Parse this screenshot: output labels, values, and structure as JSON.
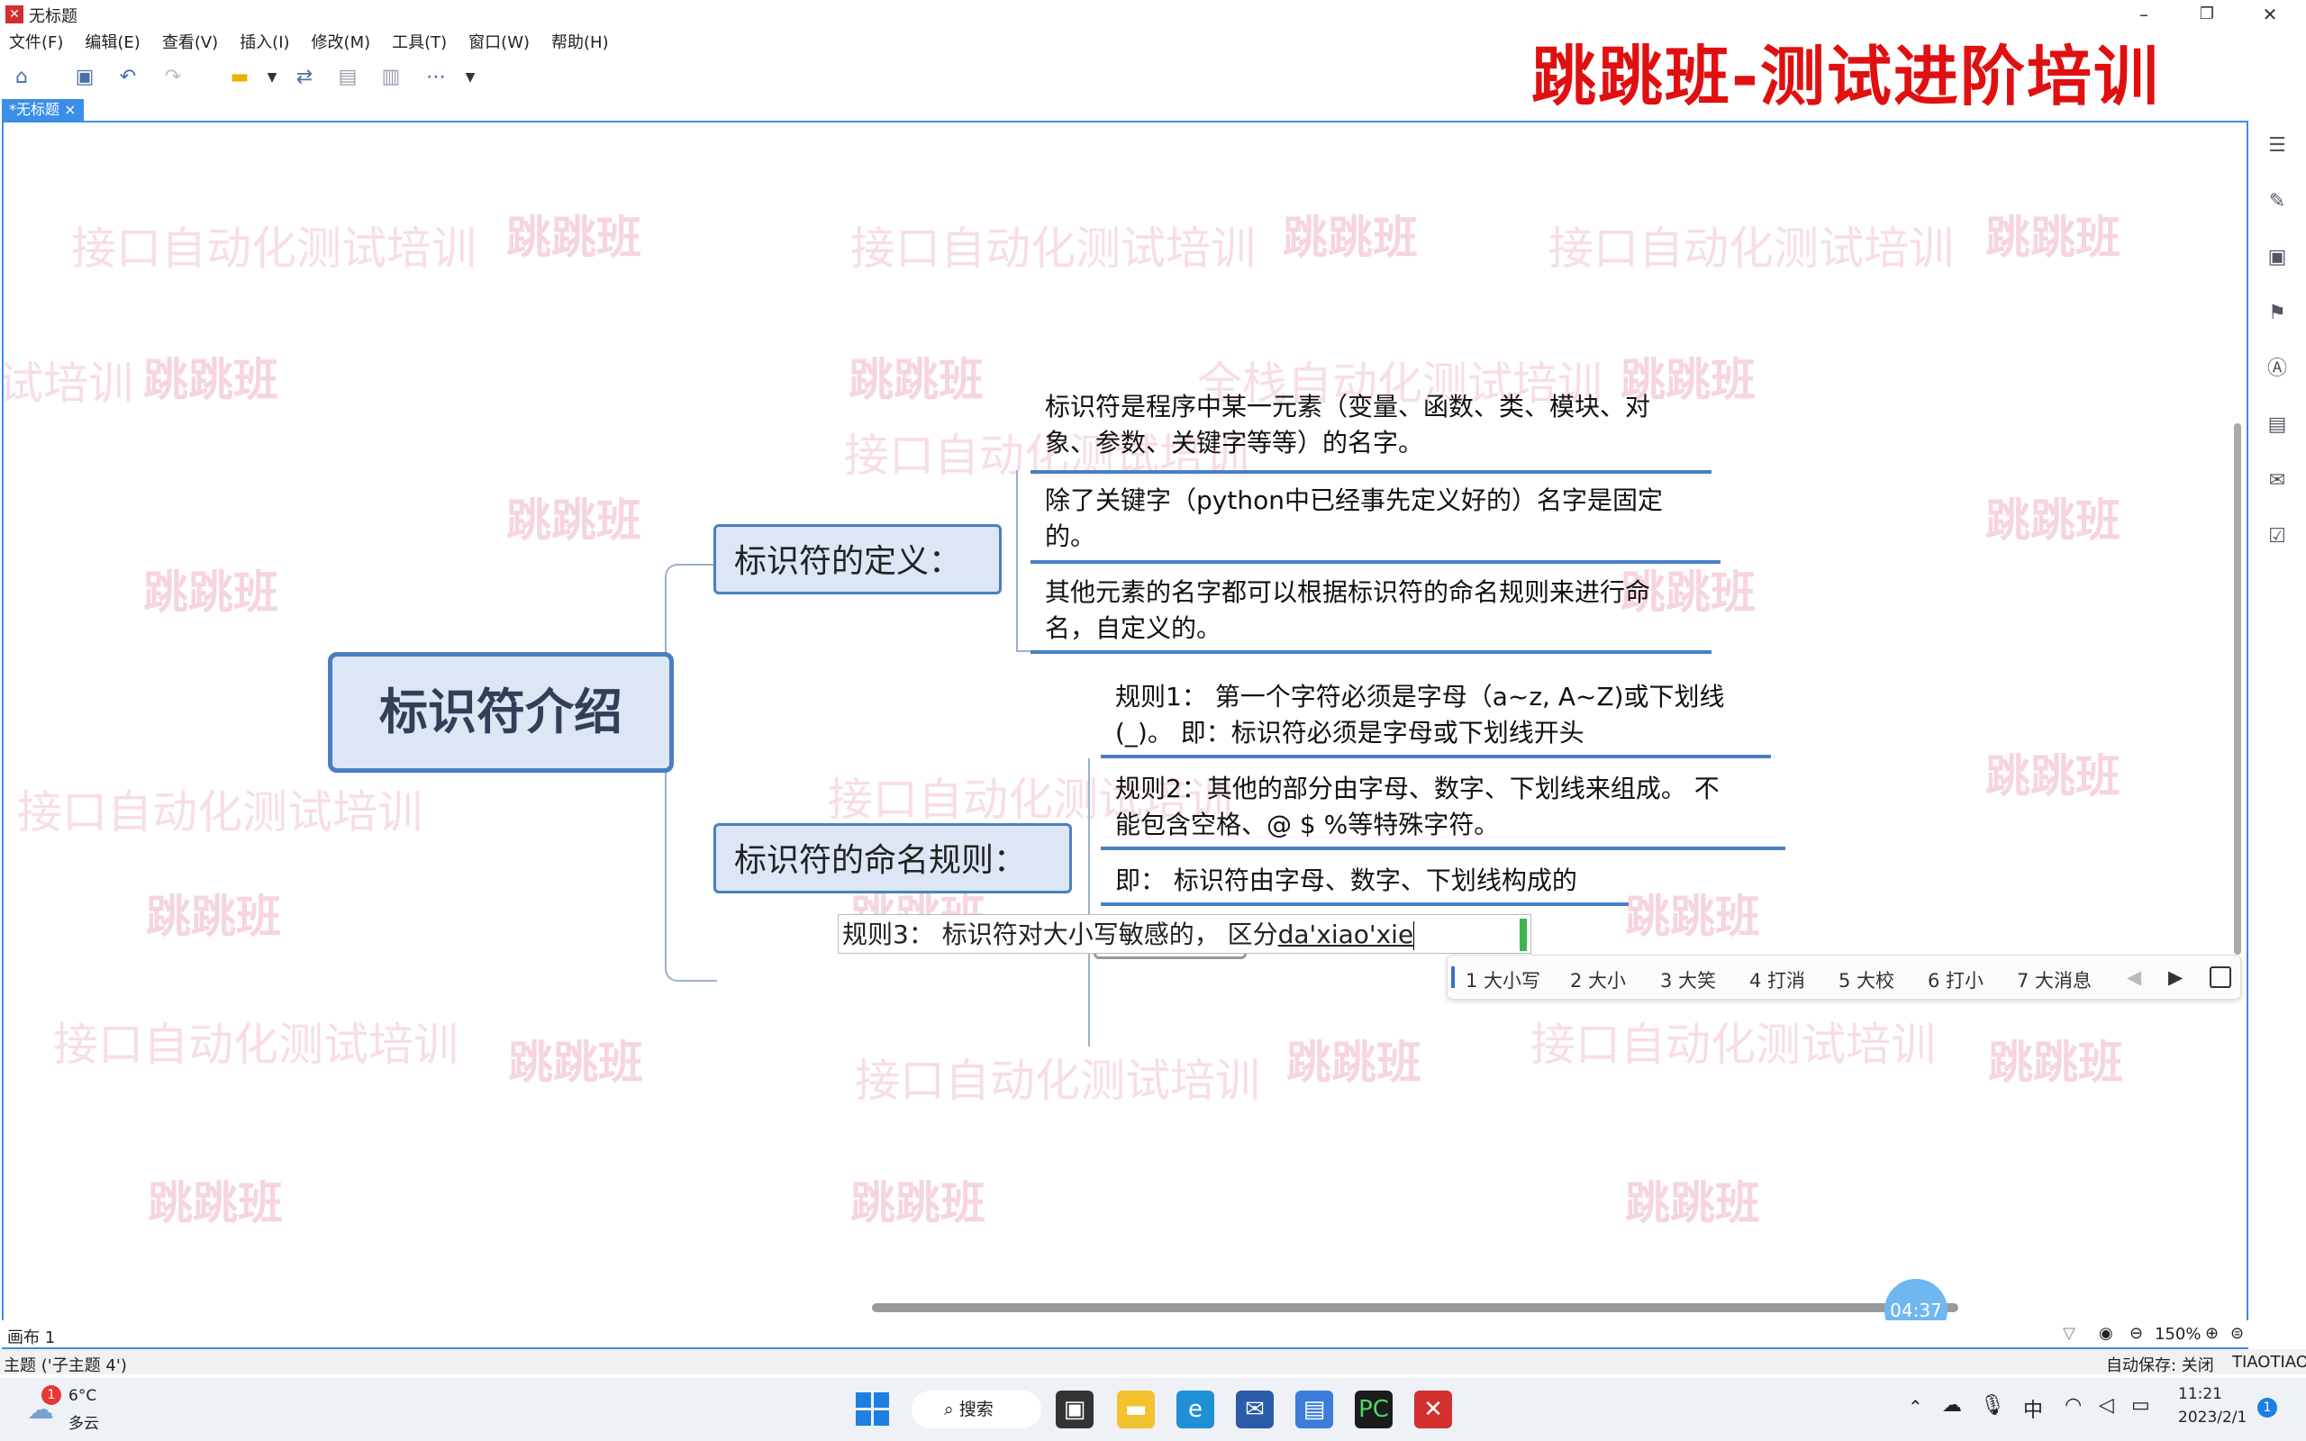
{
  "window": {
    "title": "无标题",
    "controls": {
      "minimize": "–",
      "restore": "❐",
      "close": "✕"
    }
  },
  "menu": [
    "文件(F)",
    "编辑(E)",
    "查看(V)",
    "插入(I)",
    "修改(M)",
    "工具(T)",
    "窗口(W)",
    "帮助(H)"
  ],
  "banner": "跳跳班-测试进阶培训",
  "tab": {
    "label": "*无标题",
    "close": "×"
  },
  "watermarks": {
    "brand": "跳跳班",
    "api": "接口自动化测试培训",
    "fullstack": "全栈自动化测试培训",
    "fragment": "试培训"
  },
  "mindmap": {
    "root": "标识符介绍",
    "definition": {
      "title": "标识符的定义：",
      "items": [
        [
          "标识符是程序中某一元素（变量、函数、类、模块、对",
          "象、参数、关键字等等）的名字。"
        ],
        [
          "除了关键字（python中已经事先定义好的）名字是固定",
          "的。"
        ],
        [
          "其他元素的名字都可以根据标识符的命名规则来进行命",
          "名，自定义的。"
        ]
      ]
    },
    "rules": {
      "title": "标识符的命名规则：",
      "items": [
        [
          "规则1： 第一个字符必须是字母（a~z, A~Z)或下划线",
          "(_)。 即：标识符必须是字母或下划线开头"
        ],
        [
          "规则2：其他的部分由字母、数字、下划线来组成。 不",
          "能包含空格、@ $ %等特殊字符。"
        ],
        [
          "即： 标识符由字母、数字、下划线构成的"
        ]
      ]
    },
    "editing": {
      "prefix": "规则3：  标识符对大小写敏感的，  区分",
      "composition": "da'xiao'xie"
    }
  },
  "ime": {
    "candidates": [
      "1 大小写",
      "2 大小",
      "3 大笑",
      "4 打消",
      "5 大校",
      "6 打小",
      "7 大消息"
    ],
    "prev": "◀",
    "next": "▶"
  },
  "timer": "04:37",
  "status": {
    "canvas": "画布 1",
    "zoom": "150%",
    "topic": "主题 ('子主题 4')",
    "autosave": "自动保存: 关闭",
    "user": "TIAOTIAO"
  },
  "taskbar": {
    "weather_temp": "6°C",
    "weather_desc": "多云",
    "weather_badge": "1",
    "search": "搜索",
    "ime_lang": "中",
    "time": "11:21",
    "date": "2023/2/1",
    "notif": "1"
  },
  "colors": {
    "accent": "#3a8ee6",
    "node_border": "#4a7fc1",
    "node_fill": "#dce6f4",
    "banner": "#e01010",
    "watermark": "#f6d4e0"
  }
}
